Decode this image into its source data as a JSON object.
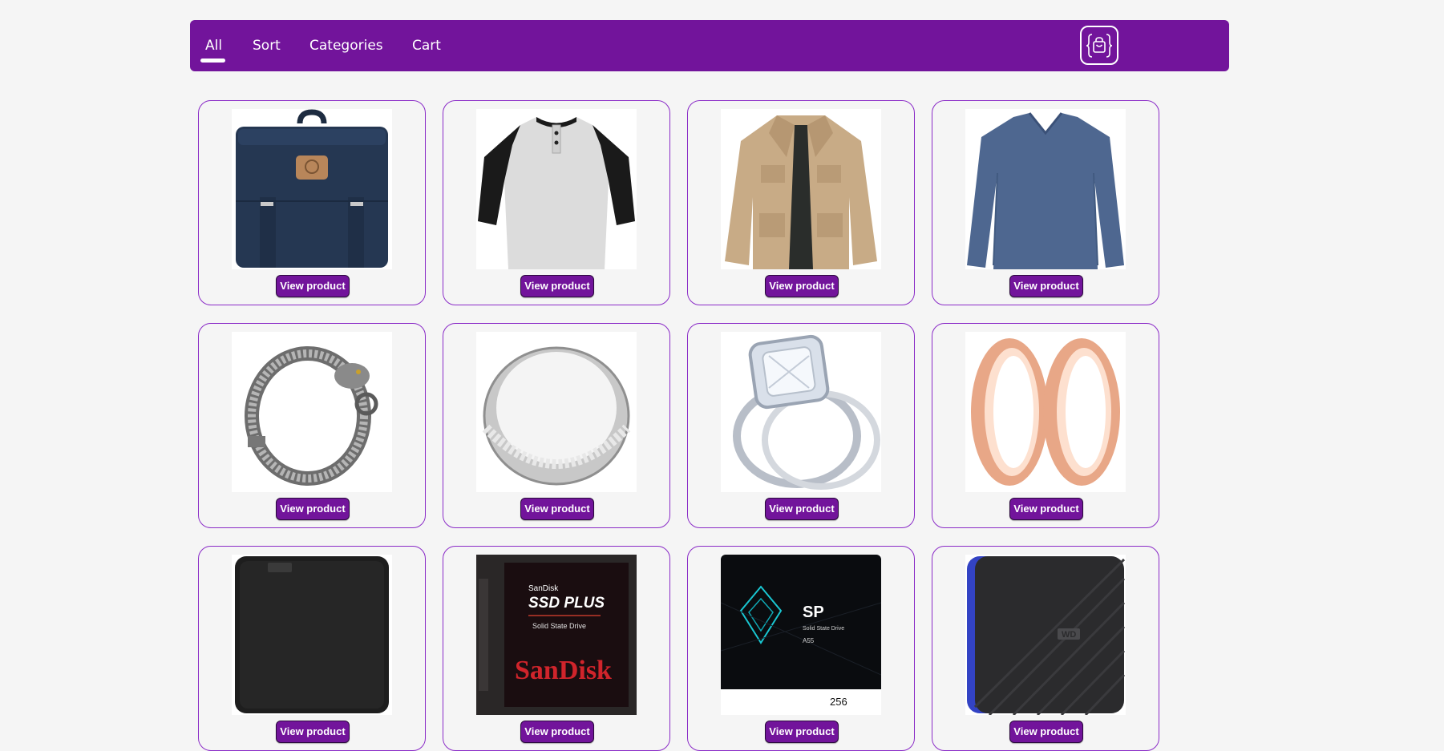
{
  "nav": {
    "tabs": [
      {
        "label": "All",
        "active": true
      },
      {
        "label": "Sort"
      },
      {
        "label": "Categories"
      },
      {
        "label": "Cart"
      }
    ],
    "cart_icon": "shopping-bag-icon"
  },
  "colors": {
    "accent": "#72149b",
    "card_border": "#8a2bc7",
    "background": "#f5f5f5"
  },
  "products": [
    {
      "image": "backpack",
      "button": "View product"
    },
    {
      "image": "raglan-henley-shirt",
      "button": "View product"
    },
    {
      "image": "khaki-jacket",
      "button": "View product"
    },
    {
      "image": "blue-long-sleeve-shirt",
      "button": "View product"
    },
    {
      "image": "dragon-chain-bracelet",
      "button": "View product"
    },
    {
      "image": "silver-band-ring",
      "button": "View product"
    },
    {
      "image": "diamond-halo-ring-set",
      "button": "View product"
    },
    {
      "image": "rose-gold-ear-tunnels",
      "button": "View product"
    },
    {
      "image": "wd-external-hard-drive",
      "button": "View product"
    },
    {
      "image": "sandisk-ssd-plus",
      "button": "View product",
      "drive_text": {
        "brand": "SanDisk",
        "model": "SSD PLUS",
        "sub": "Solid State Drive",
        "logo": "SanDisk"
      }
    },
    {
      "image": "silicon-power-ssd",
      "button": "View product",
      "drive_text": {
        "brand": "SP",
        "line": "Solid State Drive",
        "model": "A55",
        "capacity": "256"
      }
    },
    {
      "image": "wd-gaming-drive",
      "button": "View product",
      "drive_text": {
        "logo": "WD"
      }
    }
  ]
}
